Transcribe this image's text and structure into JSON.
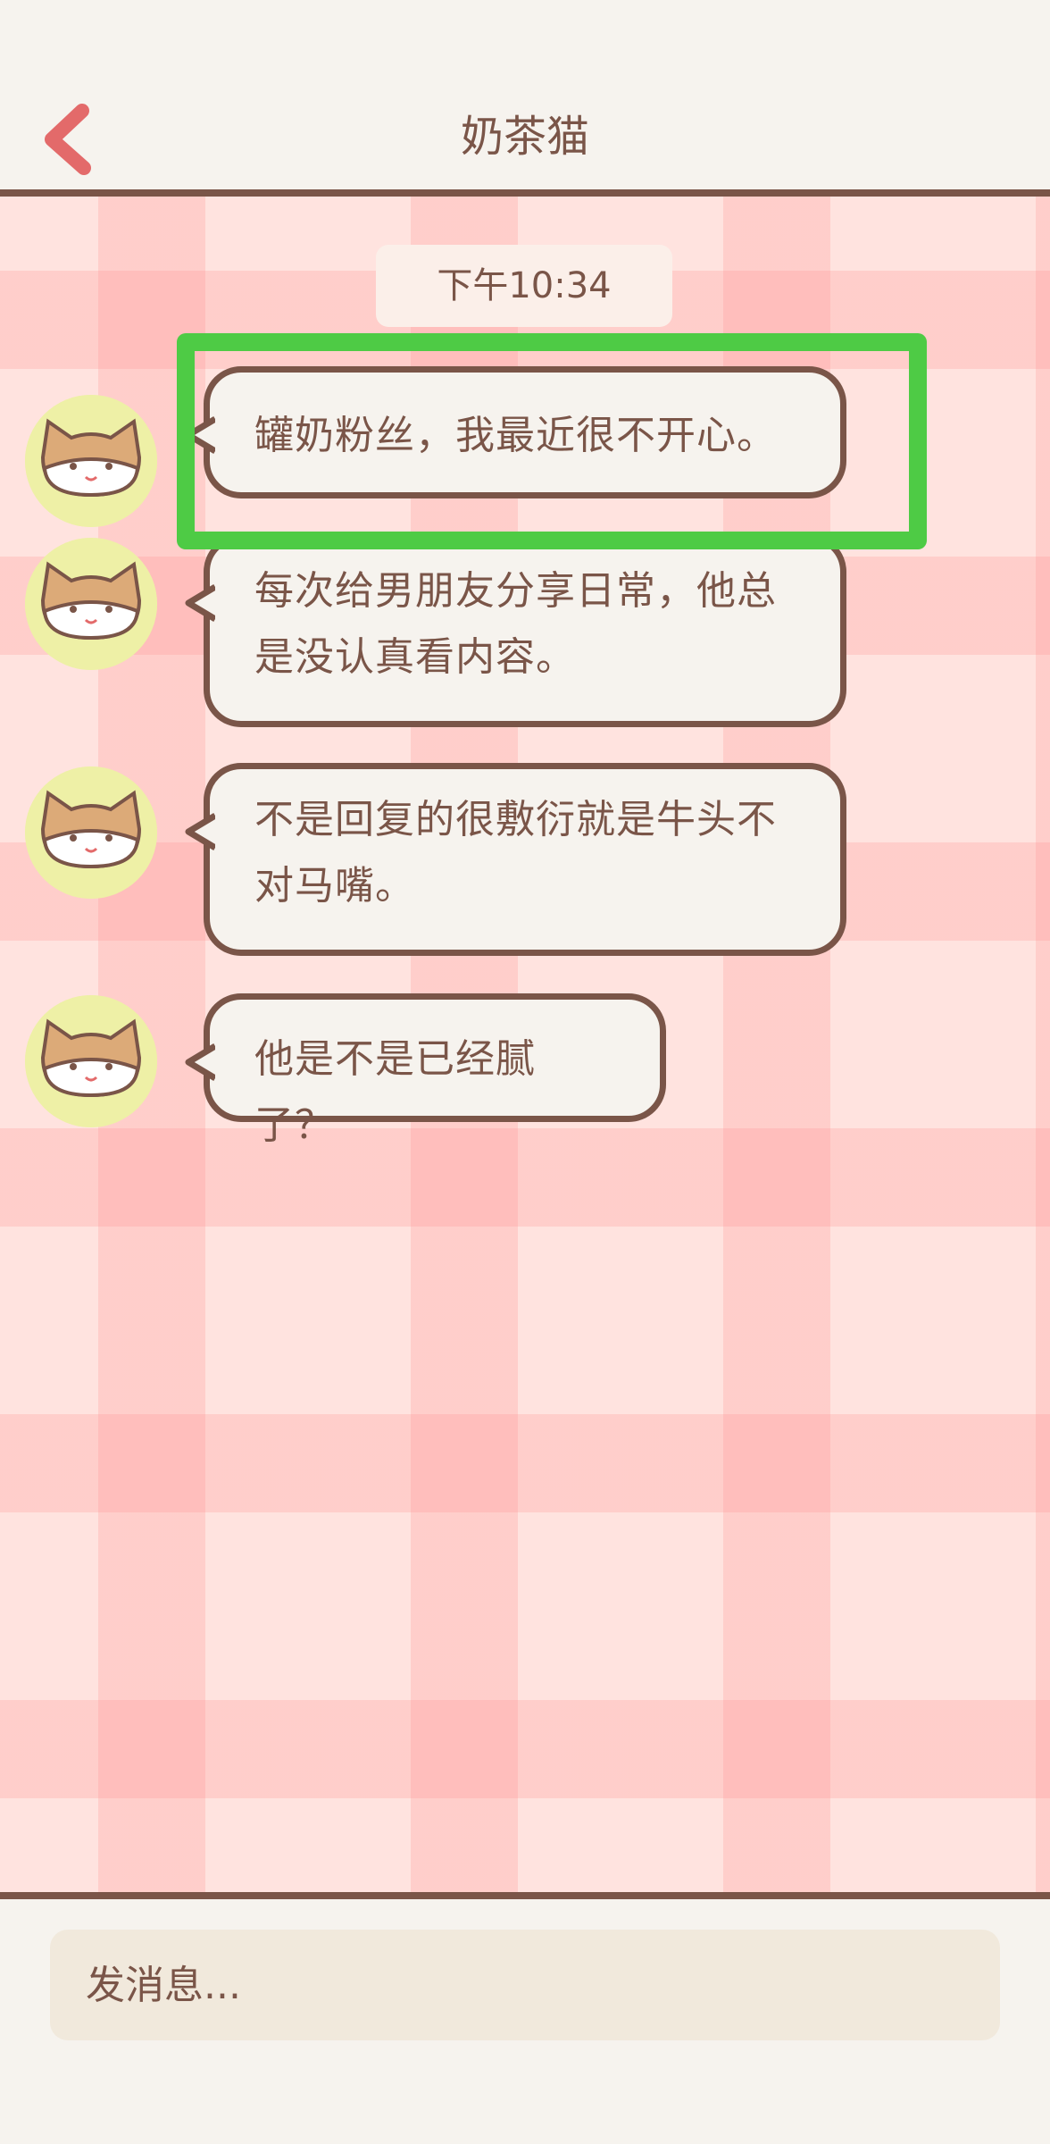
{
  "header": {
    "title": "奶茶猫",
    "back_icon": "chevron-left-icon"
  },
  "chat": {
    "timestamp": "下午10:34",
    "messages": [
      {
        "sender": "奶茶猫",
        "lines": [
          "罐奶粉丝，我最近很不开心。"
        ]
      },
      {
        "sender": "奶茶猫",
        "lines": [
          "每次给男朋友分享日常，他总",
          "是没认真看内容。"
        ]
      },
      {
        "sender": "奶茶猫",
        "lines": [
          "不是回复的很敷衍就是牛头不",
          "对马嘴。"
        ]
      },
      {
        "sender": "奶茶猫",
        "lines": [
          "他是不是已经腻了？"
        ]
      }
    ]
  },
  "input": {
    "placeholder": "发消息..."
  },
  "colors": {
    "accent_brown": "#7a5548",
    "back_arrow": "#e36a6a",
    "highlight": "#4ecb45",
    "avatar_bg": "#eef0a6",
    "bubble_bg": "#f6f3ee"
  }
}
